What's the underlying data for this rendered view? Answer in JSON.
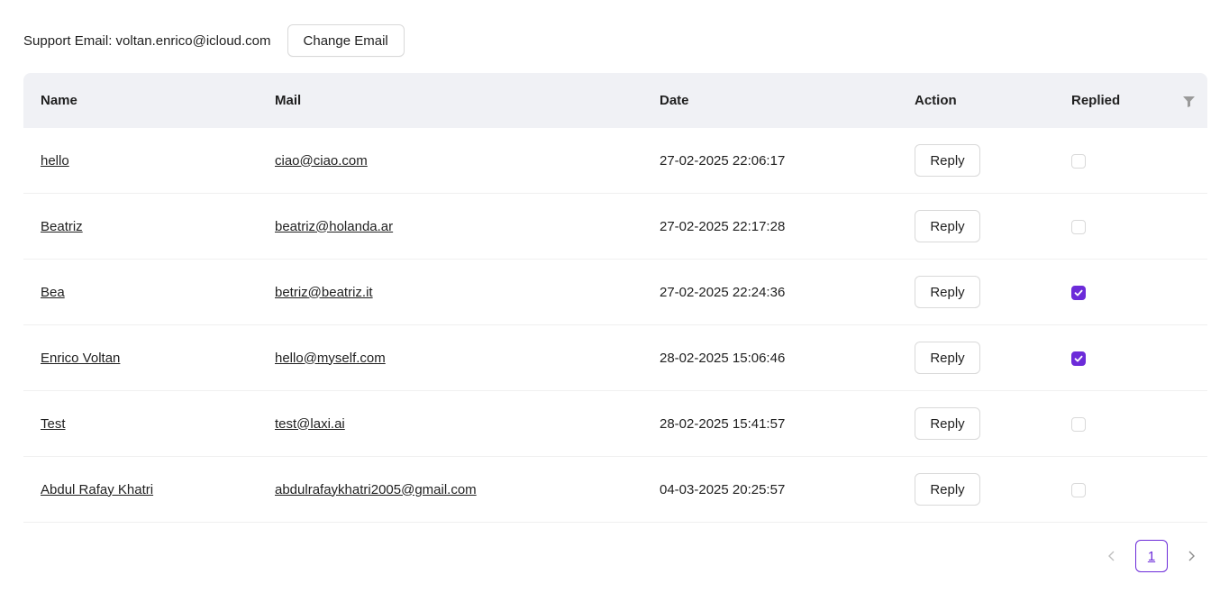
{
  "header": {
    "support_label": "Support Email: voltan.enrico@icloud.com",
    "change_email_label": "Change Email"
  },
  "table": {
    "columns": [
      "Name",
      "Mail",
      "Date",
      "Action",
      "Replied"
    ],
    "rows": [
      {
        "name": "hello",
        "mail": "ciao@ciao.com",
        "date": "27-02-2025 22:06:17",
        "action": "Reply",
        "replied": false
      },
      {
        "name": "Beatriz",
        "mail": "beatriz@holanda.ar",
        "date": "27-02-2025 22:17:28",
        "action": "Reply",
        "replied": false
      },
      {
        "name": "Bea",
        "mail": "betriz@beatriz.it",
        "date": "27-02-2025 22:24:36",
        "action": "Reply",
        "replied": true
      },
      {
        "name": "Enrico Voltan",
        "mail": "hello@myself.com",
        "date": "28-02-2025 15:06:46",
        "action": "Reply",
        "replied": true
      },
      {
        "name": "Test",
        "mail": "test@laxi.ai",
        "date": "28-02-2025 15:41:57",
        "action": "Reply",
        "replied": false
      },
      {
        "name": "Abdul Rafay Khatri",
        "mail": "abdulrafaykhatri2005@gmail.com",
        "date": "04-03-2025 20:25:57",
        "action": "Reply",
        "replied": false
      }
    ]
  },
  "pagination": {
    "current_page": "1",
    "prev_icon": "chevron-left-icon",
    "next_icon": "chevron-right-icon"
  },
  "icons": {
    "filter": "filter-icon",
    "check": "check-icon"
  },
  "colors": {
    "accent": "#6c2bd9",
    "header_bg": "#f0f1f5",
    "border": "#d9d9d9"
  }
}
